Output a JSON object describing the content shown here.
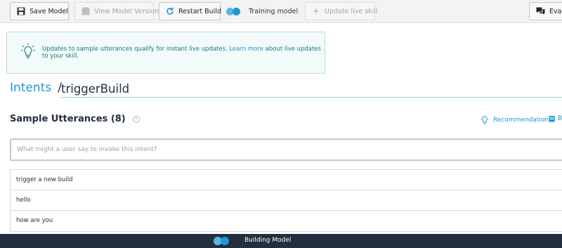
{
  "toolbar": {
    "save_label": "Save Model",
    "versions_label": "View Model Versions",
    "restart_label": "Restart Build",
    "training_label": "Training model",
    "update_label": "Update live skill",
    "evaluate_label": "Evalu"
  },
  "banner": {
    "text_before": "Updates to sample utterances qualify for instant live updates. ",
    "link_text": "Learn more",
    "text_after": " about live updates to your skill."
  },
  "breadcrumb": {
    "parent": "Intents",
    "separator": "/",
    "intent_name": "triggerBuild"
  },
  "utterances": {
    "title": "Sample Utterances (8)",
    "help": "?",
    "recommendations_label": "Recommendations",
    "bulk_label": "B",
    "placeholder": "What might a user say to invoke this intent?",
    "items": [
      "trigger a new build",
      "hello",
      "how are you"
    ]
  },
  "status": {
    "text": "Building Model"
  },
  "colors": {
    "accent": "#1b98d3",
    "banner_bg": "#f2fafa",
    "banner_text": "#16797e",
    "status_bg": "#232f3e"
  }
}
